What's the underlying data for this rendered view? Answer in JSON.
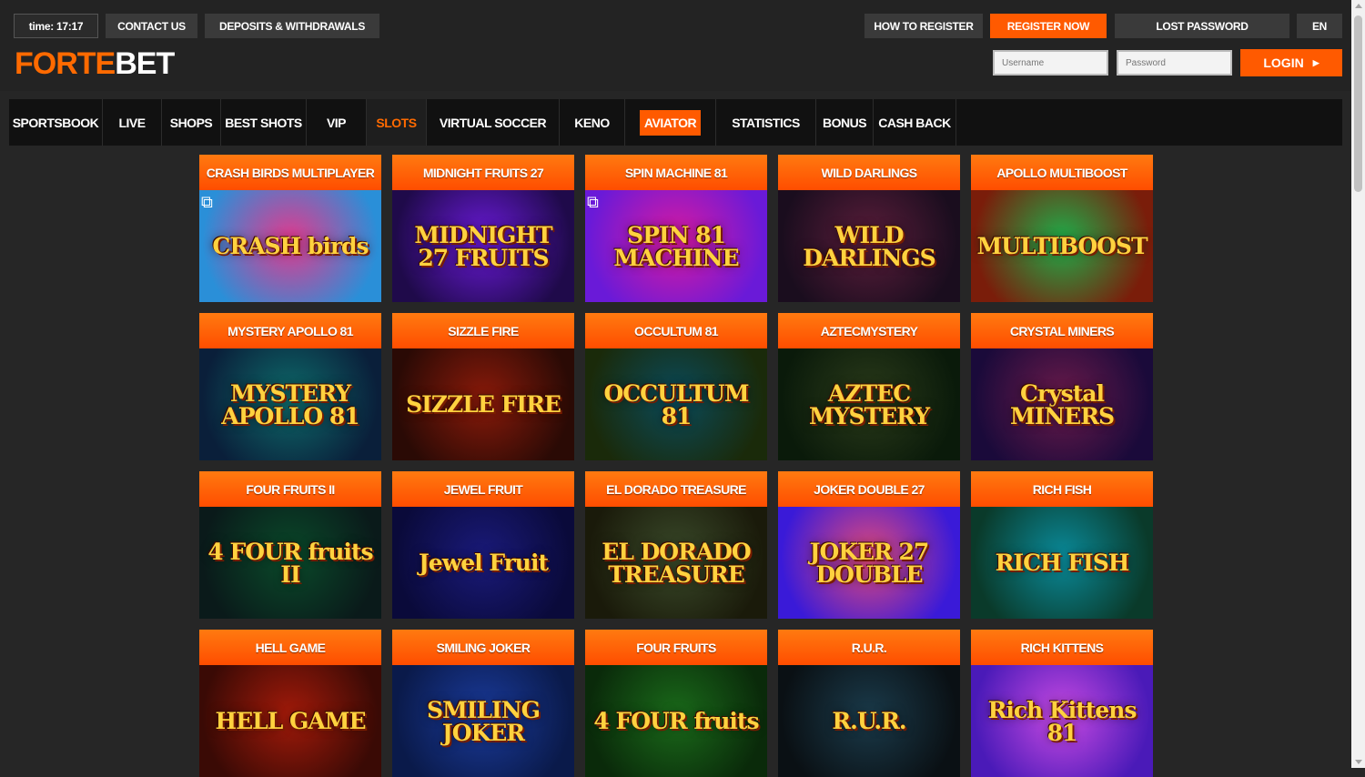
{
  "header": {
    "time": "time: 17:17",
    "contact": "CONTACT US",
    "deposits": "DEPOSITS & WITHDRAWALS",
    "how_to_register": "HOW TO REGISTER",
    "register_now": "REGISTER NOW",
    "lost_password": "LOST PASSWORD",
    "language": "EN",
    "logo_left": "FORTE",
    "logo_right": "BET",
    "username_placeholder": "Username",
    "password_placeholder": "Password",
    "login": "LOGIN"
  },
  "nav": [
    {
      "label": "SPORTSBOOK"
    },
    {
      "label": "LIVE"
    },
    {
      "label": "SHOPS"
    },
    {
      "label": "BEST SHOTS"
    },
    {
      "label": "VIP"
    },
    {
      "label": "SLOTS",
      "active": true
    },
    {
      "label": "VIRTUAL SOCCER"
    },
    {
      "label": "KENO"
    },
    {
      "label": "AVIATOR",
      "highlight": true
    },
    {
      "label": "STATISTICS"
    },
    {
      "label": "BONUS"
    },
    {
      "label": "CASH BACK"
    }
  ],
  "games": [
    {
      "title": "CRASH BIRDS MULTIPLAYER",
      "art_text": "CRASH birds",
      "c1": "#e23a8e",
      "c2": "#2a8fd8"
    },
    {
      "title": "MIDNIGHT FRUITS 27",
      "art_text": "MIDNIGHT 27 FRUITS",
      "c1": "#6a1ad8",
      "c2": "#1f0a4a"
    },
    {
      "title": "SPIN MACHINE 81",
      "art_text": "SPIN 81 MACHINE",
      "c1": "#d81aa0",
      "c2": "#6a1ad8"
    },
    {
      "title": "WILD DARLINGS",
      "art_text": "WILD DARLINGS",
      "c1": "#5a1d3a",
      "c2": "#1a0d1e"
    },
    {
      "title": "APOLLO MULTIBOOST",
      "art_text": "MULTIBOOST",
      "c1": "#1fae4a",
      "c2": "#7a1d0a"
    },
    {
      "title": "MYSTERY APOLLO 81",
      "art_text": "MYSTERY APOLLO 81",
      "c1": "#0e6a6a",
      "c2": "#0a1f3a"
    },
    {
      "title": "SIZZLE FIRE",
      "art_text": "SIZZLE FIRE",
      "c1": "#8a1a0a",
      "c2": "#2a0a05"
    },
    {
      "title": "OCCULTUM 81",
      "art_text": "OCCULTUM 81",
      "c1": "#0a4a5a",
      "c2": "#1a2a0a"
    },
    {
      "title": "AZTECMYSTERY",
      "art_text": "AZTEC MYSTERY",
      "c1": "#2a3a1a",
      "c2": "#0a1a0a"
    },
    {
      "title": "CRYSTAL MINERS",
      "art_text": "Crystal MINERS",
      "c1": "#6a1a4a",
      "c2": "#1a0a3a"
    },
    {
      "title": "FOUR FRUITS II",
      "art_text": "4 FOUR fruits II",
      "c1": "#0a4a2a",
      "c2": "#0a1a1a"
    },
    {
      "title": "JEWEL FRUIT",
      "art_text": "Jewel Fruit",
      "c1": "#1a1a7a",
      "c2": "#0a0a3a"
    },
    {
      "title": "EL DORADO TREASURE",
      "art_text": "EL DORADO TREASURE",
      "c1": "#3a4a2a",
      "c2": "#1a1a0a"
    },
    {
      "title": "JOKER DOUBLE 27",
      "art_text": "JOKER 27 DOUBLE",
      "c1": "#e24a7a",
      "c2": "#3a1ad8"
    },
    {
      "title": "RICH FISH",
      "art_text": "RICH FISH",
      "c1": "#0a8a9a",
      "c2": "#0a3a2a"
    },
    {
      "title": "HELL GAME",
      "art_text": "HELL GAME",
      "c1": "#a21a0a",
      "c2": "#3a0a05"
    },
    {
      "title": "SMILING JOKER",
      "art_text": "SMILING JOKER",
      "c1": "#1a3a9a",
      "c2": "#0a1a4a"
    },
    {
      "title": "FOUR FRUITS",
      "art_text": "4 FOUR fruits",
      "c1": "#1a6a1a",
      "c2": "#0a2a0a"
    },
    {
      "title": "R.U.R.",
      "art_text": "R.U.R.",
      "c1": "#1a3a4a",
      "c2": "#0a1014"
    },
    {
      "title": "RICH KITTENS",
      "art_text": "Rich Kittens 81",
      "c1": "#c84ae2",
      "c2": "#4a1ab8"
    }
  ]
}
